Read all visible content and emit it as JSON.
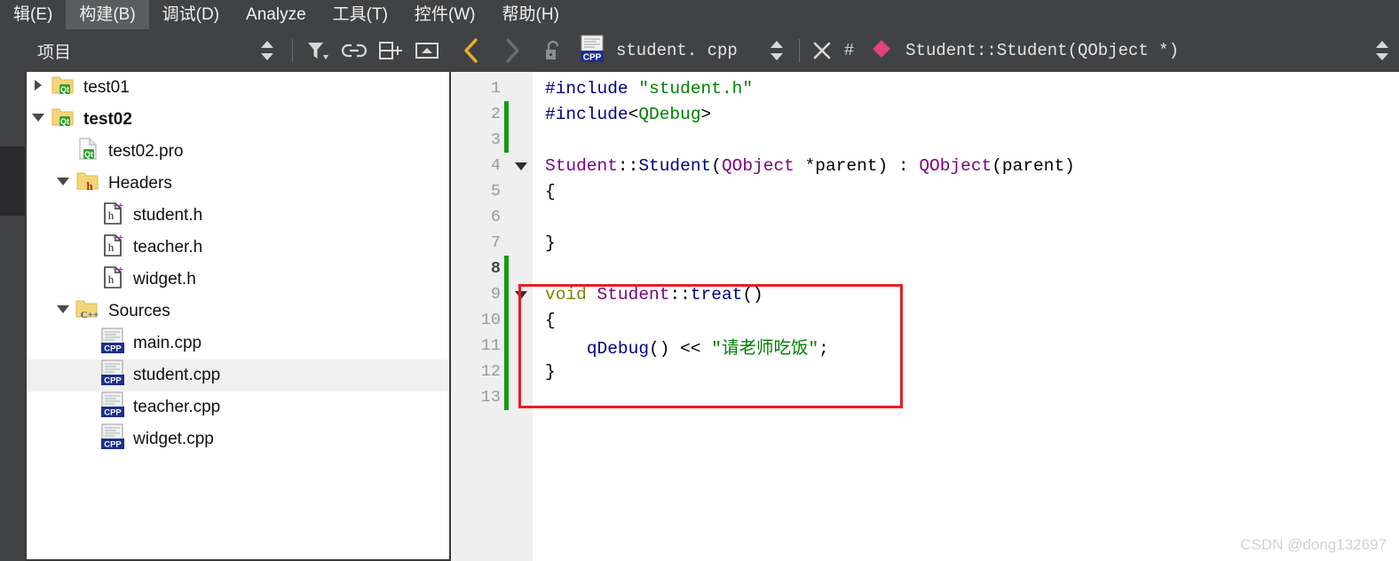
{
  "menubar": {
    "items": [
      {
        "label": "辑(E)",
        "active": false
      },
      {
        "label": "构建(B)",
        "active": true
      },
      {
        "label": "调试(D)",
        "active": false
      },
      {
        "label": "Analyze",
        "active": false
      },
      {
        "label": "工具(T)",
        "active": false
      },
      {
        "label": "控件(W)",
        "active": false
      },
      {
        "label": "帮助(H)",
        "active": false
      }
    ]
  },
  "project_panel": {
    "title": "项目",
    "tools": [
      {
        "name": "sync-stepper-icon",
        "title": ""
      },
      {
        "name": "filter-icon",
        "title": ""
      },
      {
        "name": "link-icon",
        "title": ""
      },
      {
        "name": "split-add-icon",
        "title": ""
      },
      {
        "name": "collapse-icon",
        "title": ""
      }
    ],
    "tree": [
      {
        "label": "test01",
        "indent": 0,
        "twisty": "collapsed",
        "icon": "qt-folder-icon",
        "selected": false,
        "bold": false
      },
      {
        "label": "test02",
        "indent": 0,
        "twisty": "expanded",
        "icon": "qt-folder-icon",
        "selected": false,
        "bold": true
      },
      {
        "label": "test02.pro",
        "indent": 1,
        "twisty": "none",
        "icon": "qt-pro-file-icon",
        "selected": false,
        "bold": false
      },
      {
        "label": "Headers",
        "indent": 1,
        "twisty": "expanded",
        "icon": "h-folder-icon",
        "selected": false,
        "bold": false
      },
      {
        "label": "student.h",
        "indent": 2,
        "twisty": "none",
        "icon": "hpp-file-icon",
        "selected": false,
        "bold": false
      },
      {
        "label": "teacher.h",
        "indent": 2,
        "twisty": "none",
        "icon": "hpp-file-icon",
        "selected": false,
        "bold": false
      },
      {
        "label": "widget.h",
        "indent": 2,
        "twisty": "none",
        "icon": "hpp-file-icon",
        "selected": false,
        "bold": false
      },
      {
        "label": "Sources",
        "indent": 1,
        "twisty": "expanded",
        "icon": "cpp-folder-icon",
        "selected": false,
        "bold": false
      },
      {
        "label": "main.cpp",
        "indent": 2,
        "twisty": "none",
        "icon": "cpp-file-icon",
        "selected": false,
        "bold": false
      },
      {
        "label": "student.cpp",
        "indent": 2,
        "twisty": "none",
        "icon": "cpp-file-icon",
        "selected": true,
        "bold": false
      },
      {
        "label": "teacher.cpp",
        "indent": 2,
        "twisty": "none",
        "icon": "cpp-file-icon",
        "selected": false,
        "bold": false
      },
      {
        "label": "widget.cpp",
        "indent": 2,
        "twisty": "none",
        "icon": "cpp-file-icon",
        "selected": false,
        "bold": false
      }
    ]
  },
  "editor": {
    "back_enabled": true,
    "forward_enabled": false,
    "lock_state": "unlocked",
    "file_name": "student. cpp",
    "file_icon": "cpp-file-icon",
    "hash_label": "#",
    "symbol_name": "Student::Student(QObject *)",
    "symbol_icon": "pink-diamond-icon",
    "lines": [
      {
        "no": "1",
        "current": false,
        "changed": false,
        "fold": "none",
        "tokens": [
          {
            "t": "#include ",
            "c": "k-pre"
          },
          {
            "t": "\"student.h\"",
            "c": "k-str"
          }
        ]
      },
      {
        "no": "2",
        "current": false,
        "changed": true,
        "fold": "none",
        "tokens": [
          {
            "t": "#include",
            "c": "k-pre"
          },
          {
            "t": "<",
            "c": "k-pl"
          },
          {
            "t": "QDebug",
            "c": "k-str"
          },
          {
            "t": ">",
            "c": "k-pl"
          }
        ]
      },
      {
        "no": "3",
        "current": false,
        "changed": true,
        "fold": "none",
        "tokens": []
      },
      {
        "no": "4",
        "current": false,
        "changed": false,
        "fold": "open",
        "tokens": [
          {
            "t": "Student",
            "c": "k-type"
          },
          {
            "t": "::",
            "c": "k-pl"
          },
          {
            "t": "Student",
            "c": "k-fn"
          },
          {
            "t": "(",
            "c": "k-pl"
          },
          {
            "t": "QObject",
            "c": "k-type"
          },
          {
            "t": " *parent) : ",
            "c": "k-pl"
          },
          {
            "t": "QObject",
            "c": "k-type"
          },
          {
            "t": "(parent)",
            "c": "k-pl"
          }
        ]
      },
      {
        "no": "5",
        "current": false,
        "changed": false,
        "fold": "none",
        "tokens": [
          {
            "t": "{",
            "c": "k-pl"
          }
        ]
      },
      {
        "no": "6",
        "current": false,
        "changed": false,
        "fold": "none",
        "tokens": []
      },
      {
        "no": "7",
        "current": false,
        "changed": false,
        "fold": "none",
        "tokens": [
          {
            "t": "}",
            "c": "k-pl"
          }
        ]
      },
      {
        "no": "8",
        "current": true,
        "changed": true,
        "fold": "none",
        "tokens": []
      },
      {
        "no": "9",
        "current": false,
        "changed": true,
        "fold": "open",
        "tokens": [
          {
            "t": "void",
            "c": "k-kw"
          },
          {
            "t": " ",
            "c": "k-pl"
          },
          {
            "t": "Student",
            "c": "k-type"
          },
          {
            "t": "::",
            "c": "k-pl"
          },
          {
            "t": "treat",
            "c": "k-fn"
          },
          {
            "t": "()",
            "c": "k-pl"
          }
        ]
      },
      {
        "no": "10",
        "current": false,
        "changed": true,
        "fold": "none",
        "tokens": [
          {
            "t": "{",
            "c": "k-pl"
          }
        ]
      },
      {
        "no": "11",
        "current": false,
        "changed": true,
        "fold": "none",
        "tokens": [
          {
            "t": "    ",
            "c": "k-pl"
          },
          {
            "t": "qDebug",
            "c": "k-fn"
          },
          {
            "t": "() << ",
            "c": "k-pl"
          },
          {
            "t": "\"请老师吃饭\"",
            "c": "k-str"
          },
          {
            "t": ";",
            "c": "k-pl"
          }
        ]
      },
      {
        "no": "12",
        "current": false,
        "changed": true,
        "fold": "none",
        "tokens": [
          {
            "t": "}",
            "c": "k-pl"
          }
        ]
      },
      {
        "no": "13",
        "current": false,
        "changed": true,
        "fold": "none",
        "tokens": []
      }
    ]
  },
  "annotation": {
    "name": "red-highlight-rectangle",
    "color": "#e81d26"
  },
  "watermark": {
    "text": "CSDN @dong132697"
  }
}
